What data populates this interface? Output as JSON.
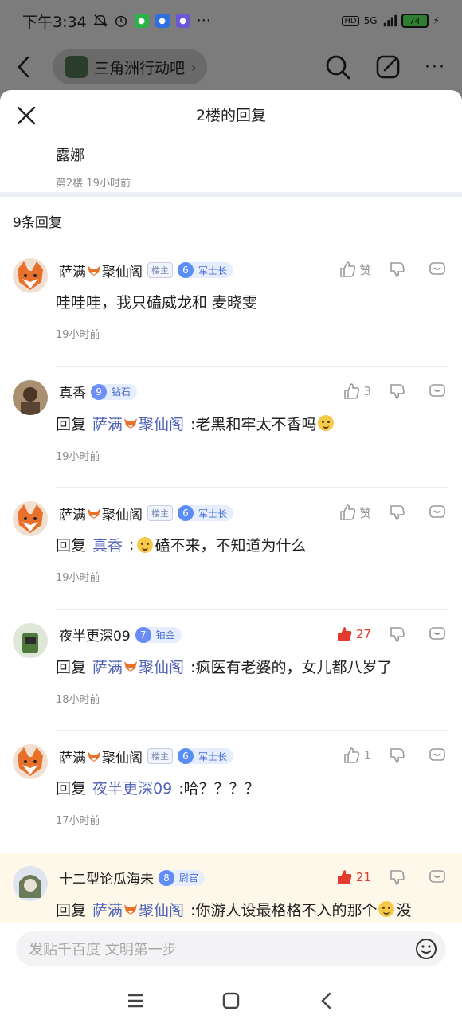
{
  "status_bar": {
    "time": "下午3:34",
    "battery": "74",
    "network": "5G"
  },
  "background_nav": {
    "forum_name": "三角洲行动吧"
  },
  "sheet": {
    "title": "2楼的回复"
  },
  "floor": {
    "text": "露娜",
    "meta": "第2楼  19小时前"
  },
  "reply_count": "9条回复",
  "replies": [
    {
      "user": "萨满🦊聚仙阁",
      "user_a": "萨满",
      "user_b": "聚仙阁",
      "owner_badge": "楼主",
      "level": "6",
      "level_name": "军士长",
      "level_color": "#5b8df6",
      "like_label": "赞",
      "content_text": "哇哇哇，我只磕威龙和 麦晓雯",
      "time": "19小时前"
    },
    {
      "user": "真香",
      "level": "9",
      "level_name": "钻石",
      "level_color": "#6d8ff8",
      "like_label": "3",
      "reply_prefix": "回复",
      "reply_target_a": "萨满",
      "reply_target_b": "聚仙阁",
      "content_text": ":老黑和牢太不香吗",
      "time": "19小时前"
    },
    {
      "user_a": "萨满",
      "user_b": "聚仙阁",
      "owner_badge": "楼主",
      "level": "6",
      "level_name": "军士长",
      "level_color": "#5b8df6",
      "like_label": "赞",
      "reply_prefix": "回复",
      "reply_target": "真香",
      "content_text": "磕不来，不知道为什么",
      "time": "19小时前"
    },
    {
      "user": "夜半更深09",
      "level": "7",
      "level_name": "铂金",
      "level_color": "#6a8cf4",
      "like_label": "27",
      "reply_prefix": "回复",
      "reply_target_a": "萨满",
      "reply_target_b": "聚仙阁",
      "content_text": ":疯医有老婆的，女儿都八岁了",
      "time": "18小时前"
    },
    {
      "user_a": "萨满",
      "user_b": "聚仙阁",
      "owner_badge": "楼主",
      "level": "6",
      "level_name": "军士长",
      "level_color": "#5b8df6",
      "like_label": "1",
      "reply_prefix": "回复",
      "reply_target": "夜半更深09",
      "content_text": ":哈？？？？",
      "time": "17小时前"
    },
    {
      "user": "十二型论瓜海未",
      "level": "8",
      "level_name": "尉官",
      "level_color": "#5f8cf5",
      "like_label": "21",
      "reply_prefix": "回复",
      "reply_target_a": "萨满",
      "reply_target_b": "聚仙阁",
      "content_text": ":你游人设最格格不入的那个",
      "content_tail": "没"
    }
  ],
  "input": {
    "placeholder": "发贴千百度 文明第一步"
  },
  "colors": {
    "link": "#4f62b6",
    "hot_like": "#e33b2e",
    "level_bg": "#e6edfd"
  }
}
